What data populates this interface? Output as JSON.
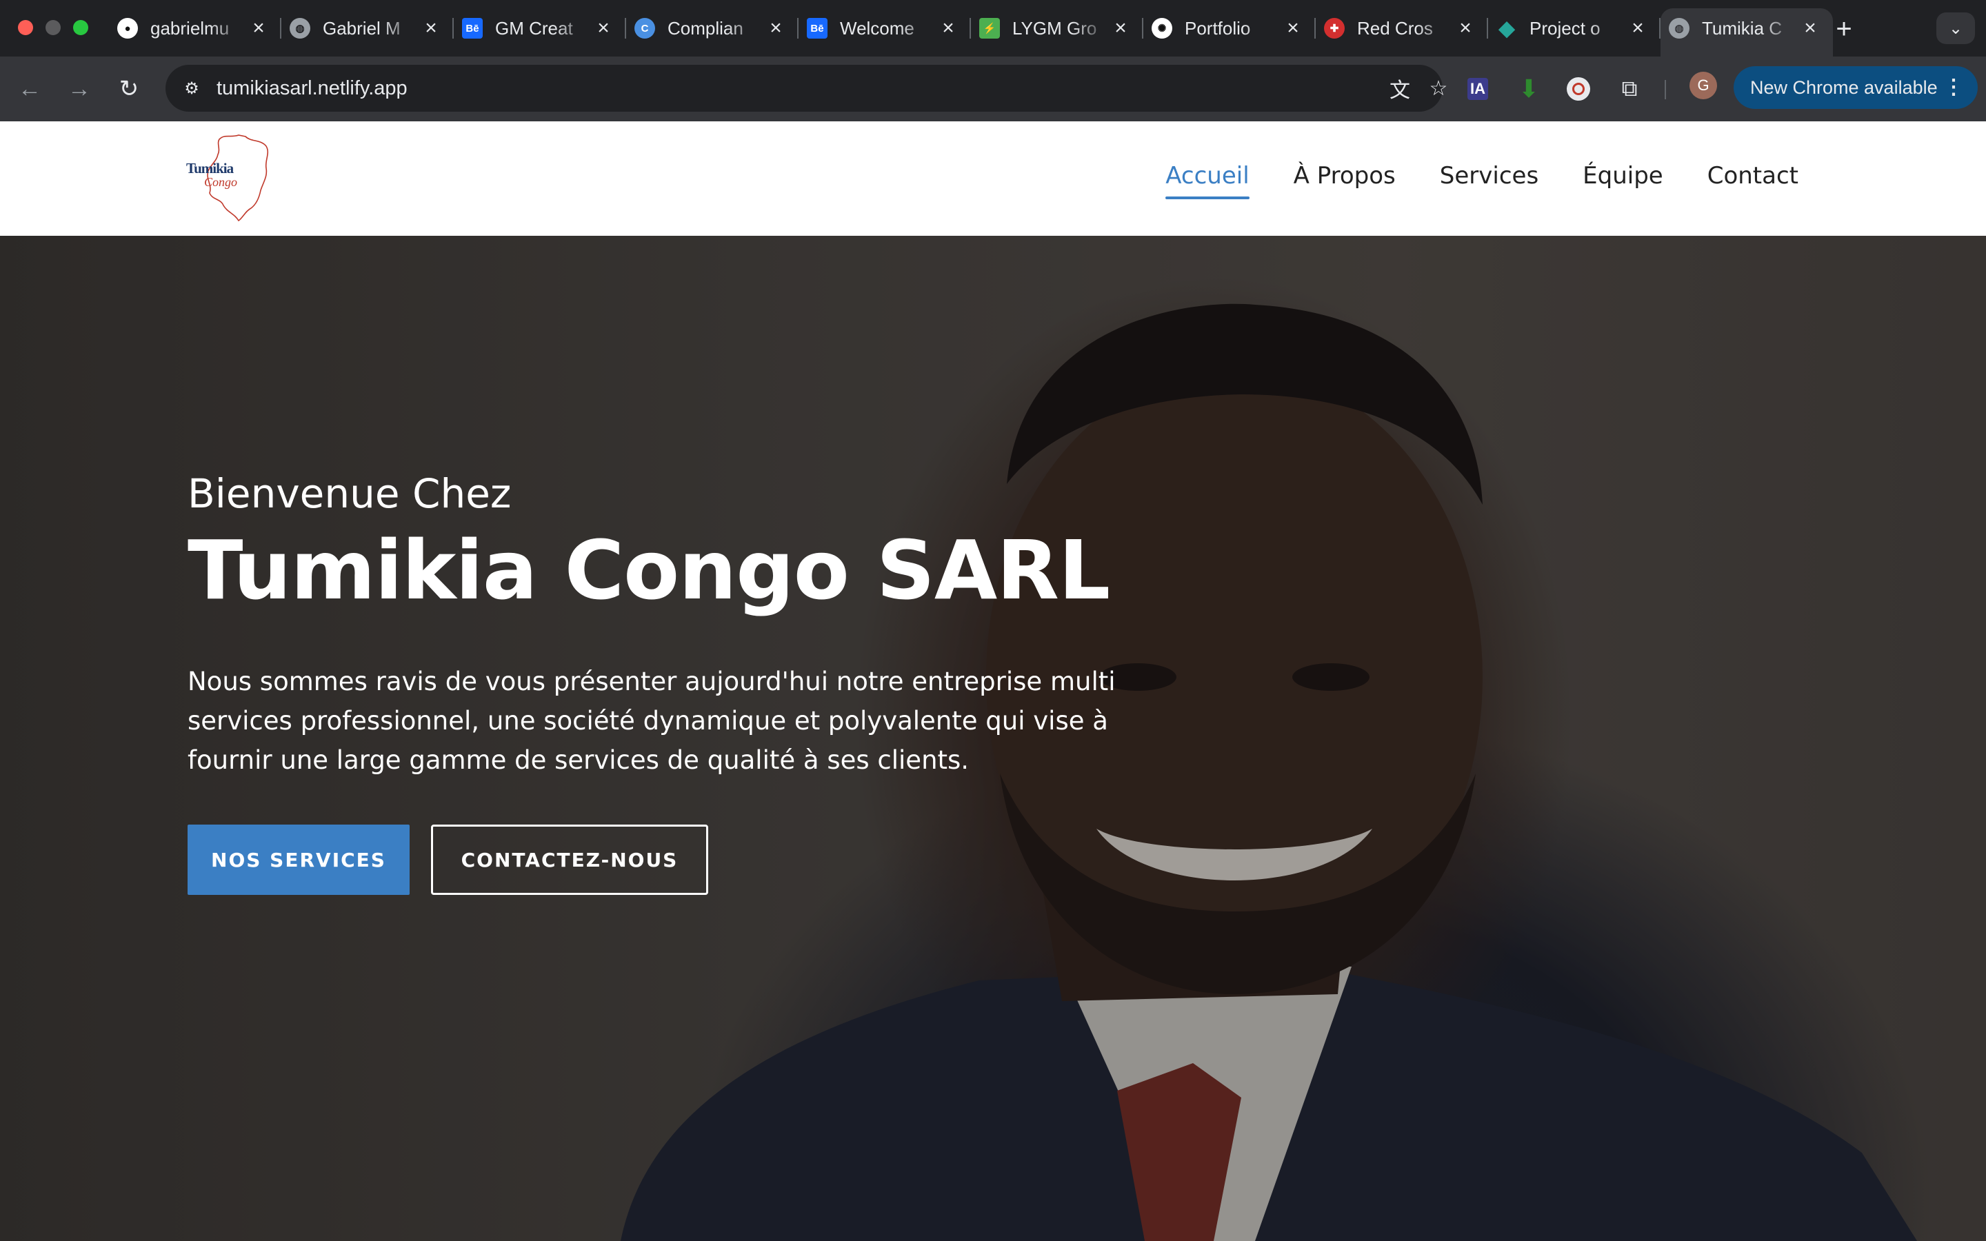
{
  "browser": {
    "tabs": [
      {
        "title": "gabrielmu",
        "icon": "github-icon",
        "color": "#ffffff"
      },
      {
        "title": "Gabriel M",
        "icon": "globe-icon",
        "color": "#9aa0a6"
      },
      {
        "title": "GM Creat",
        "icon": "behance-icon",
        "color": "#1769ff"
      },
      {
        "title": "Complian",
        "icon": "compliance-icon",
        "color": "#4a90e2"
      },
      {
        "title": "Welcome",
        "icon": "behance-icon",
        "color": "#1769ff"
      },
      {
        "title": "LYGM Gro",
        "icon": "lygm-icon",
        "color": "#4caf50"
      },
      {
        "title": "Portfolio",
        "icon": "openai-icon",
        "color": "#ffffff"
      },
      {
        "title": "Red Cros",
        "icon": "red-cross-icon",
        "color": "#d32f2f"
      },
      {
        "title": "Project o",
        "icon": "diamond-icon",
        "color": "#26a69a"
      },
      {
        "title": "Tumikia C",
        "icon": "globe-icon",
        "color": "#9aa0a6",
        "active": true
      }
    ],
    "url": "tumikiasarl.netlify.app",
    "update_label": "New Chrome available",
    "extension_ia_label": "IA",
    "avatar_initial": "G"
  },
  "site": {
    "logo_text": "Tumikia",
    "logo_script": "Congo",
    "nav": [
      {
        "label": "Accueil",
        "active": true
      },
      {
        "label": "À Propos"
      },
      {
        "label": "Services"
      },
      {
        "label": "Équipe"
      },
      {
        "label": "Contact"
      }
    ],
    "accent_color": "#3b7fc4"
  },
  "hero": {
    "welcome": "Bienvenue Chez",
    "title": "Tumikia Congo SARL",
    "description": "Nous sommes ravis de vous présenter aujourd'hui notre entreprise multi services professionnel, une société dynamique et polyvalente qui vise à fournir une large gamme de services de qualité à ses clients.",
    "primary_button": "NOS SERVICES",
    "secondary_button": "CONTACTEZ-NOUS"
  }
}
